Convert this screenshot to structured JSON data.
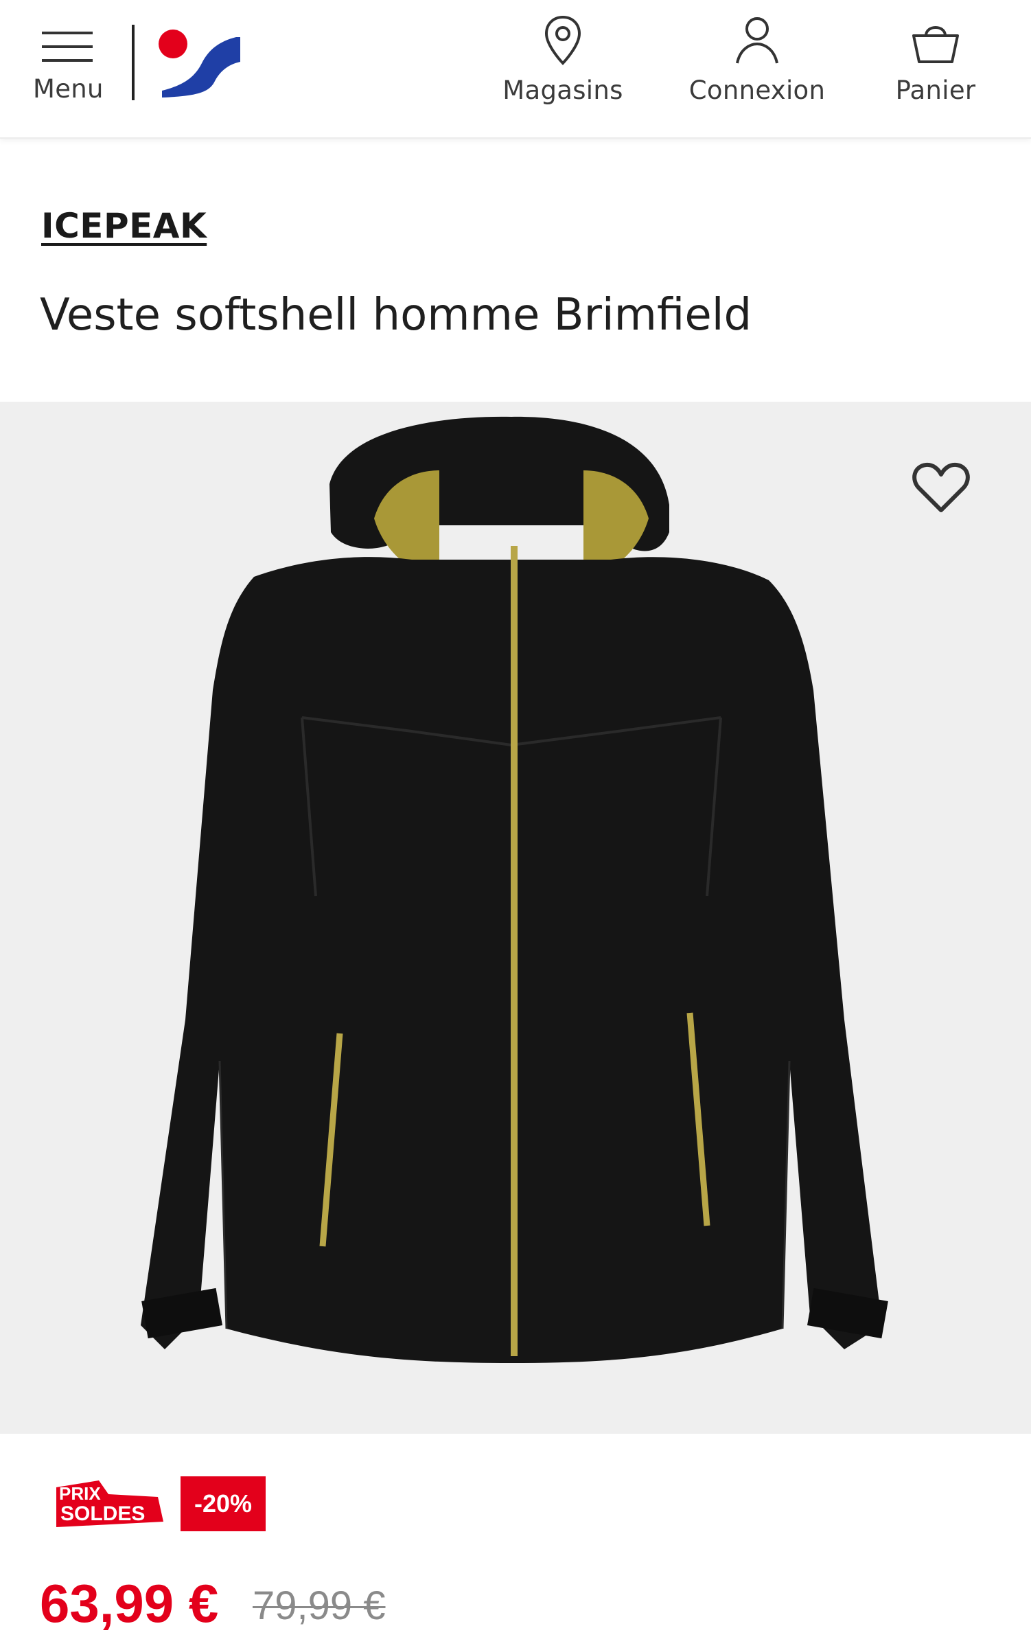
{
  "header": {
    "menu_label": "Menu",
    "stores_label": "Magasins",
    "login_label": "Connexion",
    "cart_label": "Panier",
    "icons": {
      "menu": "hamburger-icon",
      "stores": "location-pin-icon",
      "login": "user-icon",
      "cart": "basket-icon",
      "logo": "intersport-logo"
    }
  },
  "product": {
    "brand": "ICEPEAK",
    "title": "Veste softshell homme Brimfield",
    "image": "black-softshell-jacket-with-hood",
    "favorite_icon": "heart-icon",
    "promo_badge_line1": "PRIX",
    "promo_badge_line2": "SOLDES",
    "discount": "-20%",
    "price": "63,99 €",
    "old_price": "79,99 €"
  },
  "colors": {
    "accent_red": "#e3001b",
    "logo_blue": "#1f3fa6",
    "zipper_gold": "#b8a647",
    "jacket_black": "#151515"
  }
}
